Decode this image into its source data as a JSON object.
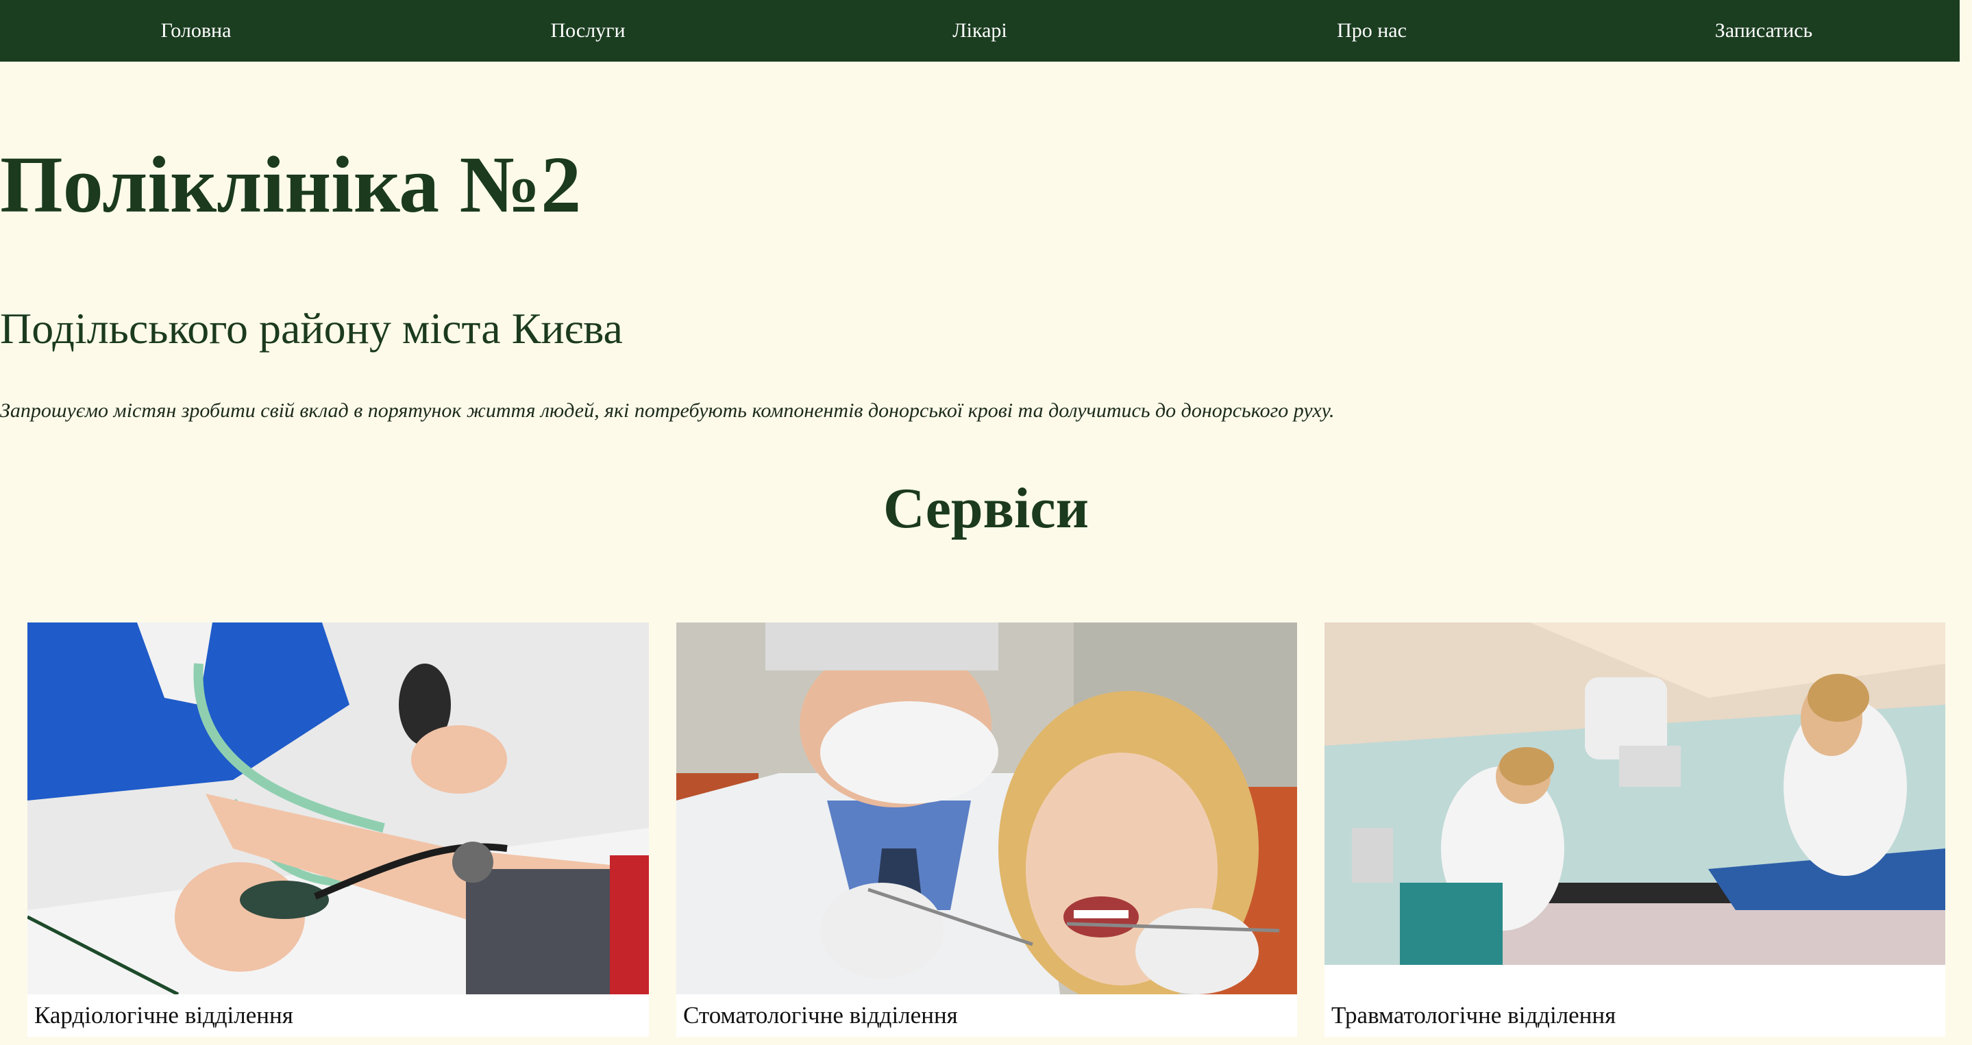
{
  "nav": {
    "items": [
      {
        "label": "Головна"
      },
      {
        "label": "Послуги"
      },
      {
        "label": "Лікарі"
      },
      {
        "label": "Про нас"
      },
      {
        "label": "Записатись"
      }
    ]
  },
  "hero": {
    "title": "Поліклініка №2",
    "subtitle": "Подільського району міста Києва",
    "intro": "Запрошуємо містян зробити свій вклад в порятунок життя людей, які потребують компонентів донорської крові та долучитись до донорського руху."
  },
  "services": {
    "heading": "Сервіси",
    "cards": [
      {
        "caption": "Кардіологічне відділення"
      },
      {
        "caption": "Стоматологічне відділення"
      },
      {
        "caption": "Травматологічне відділення"
      }
    ]
  },
  "colors": {
    "nav_bg": "#1b3d20",
    "page_bg": "#fdfaea",
    "heading": "#1b3a1e"
  }
}
